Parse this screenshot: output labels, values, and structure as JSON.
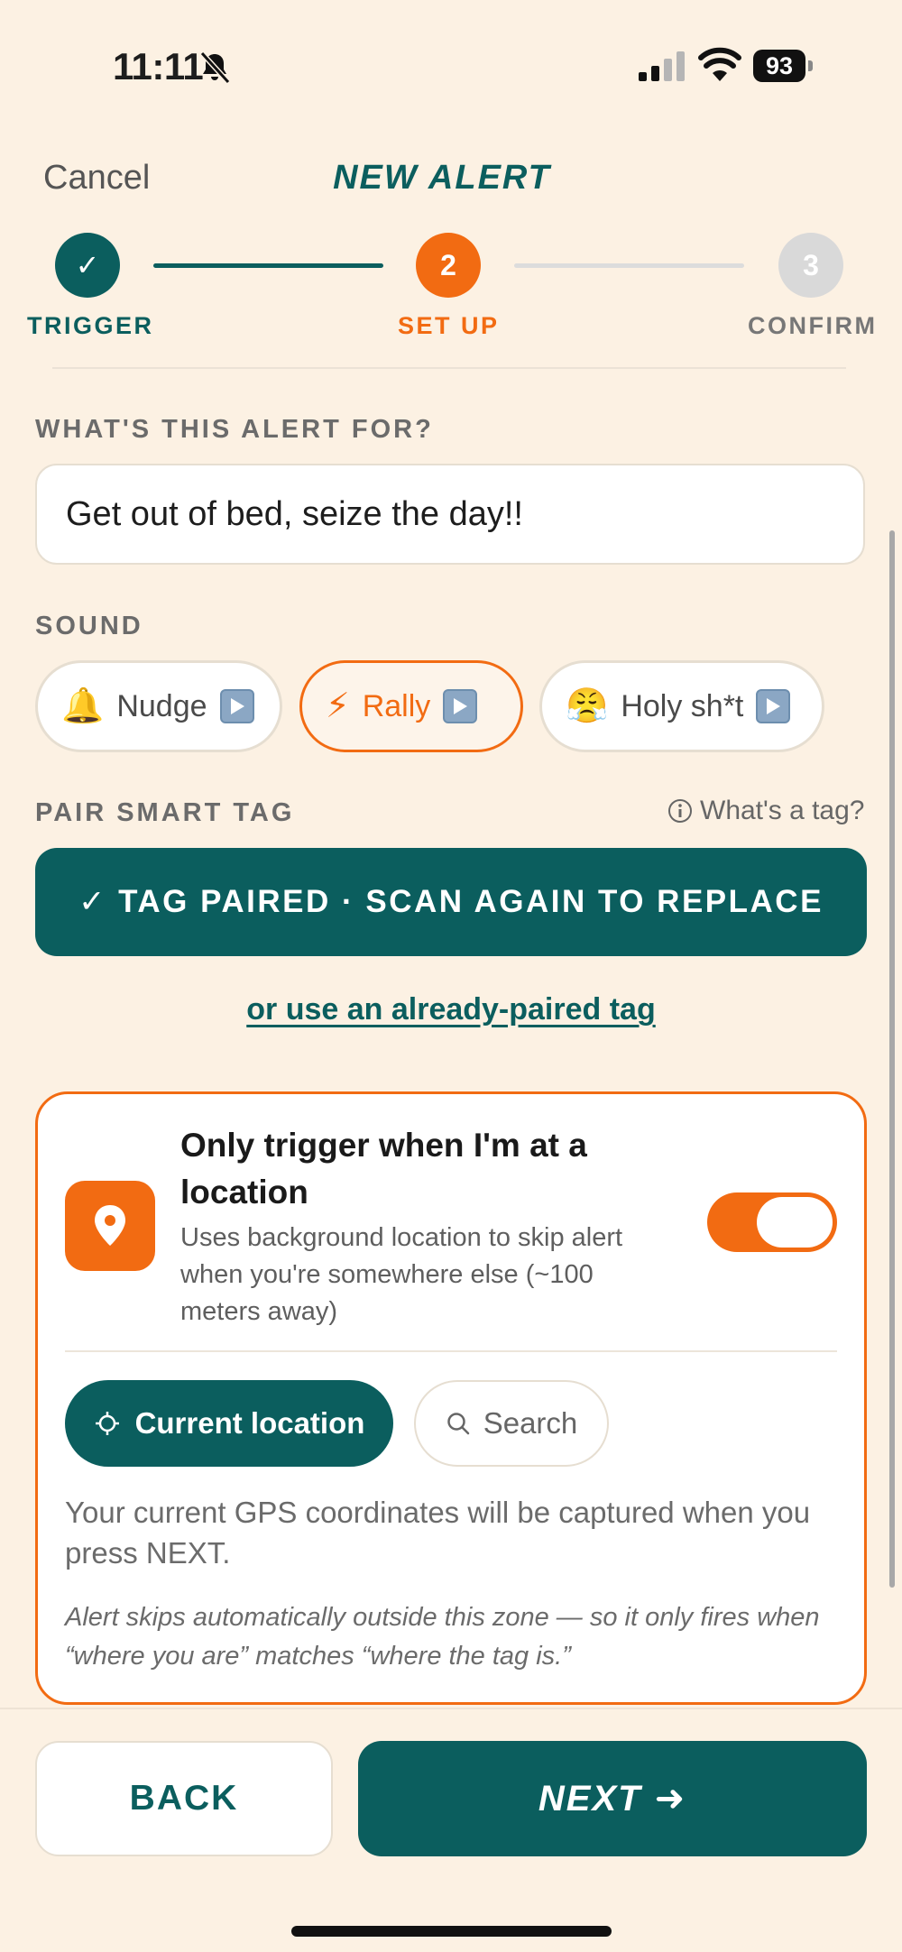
{
  "status_bar": {
    "time": "11:11",
    "battery": "93"
  },
  "header": {
    "cancel": "Cancel",
    "title": "NEW ALERT"
  },
  "stepper": {
    "steps": [
      {
        "label": "TRIGGER",
        "marker": "✓"
      },
      {
        "label": "SET UP",
        "marker": "2"
      },
      {
        "label": "CONFIRM",
        "marker": "3"
      }
    ]
  },
  "alert_for": {
    "label": "WHAT'S THIS ALERT FOR?",
    "value": "Get out of bed, seize the day!!"
  },
  "sound": {
    "label": "SOUND",
    "options": [
      {
        "emoji": "🔔",
        "label": "Nudge",
        "selected": false
      },
      {
        "emoji": "⚡",
        "label": "Rally",
        "selected": true
      },
      {
        "emoji": "😤",
        "label": "Holy sh*t",
        "selected": false
      }
    ]
  },
  "smart_tag": {
    "label": "PAIR SMART TAG",
    "help": "What's a tag?",
    "paired_button": "✓ TAG PAIRED · SCAN AGAIN TO REPLACE",
    "alt_link": "or use an already-paired tag"
  },
  "location": {
    "title": "Only trigger when I'm at a location",
    "description": "Uses background location to skip alert when you're somewhere else (~100 meters away)",
    "enabled": true,
    "current_button": "Current location",
    "search_button": "Search",
    "gps_note": "Your current GPS coordinates will be captured when you press NEXT.",
    "skip_note": "Alert skips automatically outside this zone — so it only fires when “where you are” matches “where the tag is.”"
  },
  "footer": {
    "back": "BACK",
    "next": "NEXT",
    "next_arrow": "➜"
  },
  "colors": {
    "teal": "#0b5e5e",
    "orange": "#f26b12",
    "background": "#fcf1e3"
  }
}
